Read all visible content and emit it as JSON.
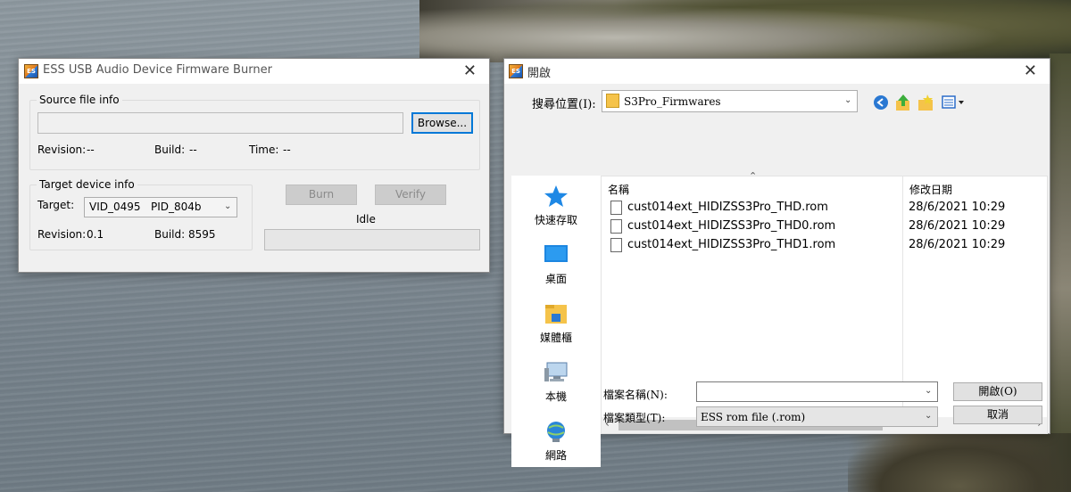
{
  "colors": {
    "accent": "#0078d7",
    "folder_yellow": "#f5c34a",
    "window_bg": "#f0f0f0"
  },
  "burner": {
    "title": "ESS USB Audio Device Firmware Burner",
    "close_label": "✕",
    "source_group_label": "Source file info",
    "source_path_value": "",
    "browse_label": "Browse...",
    "revision_label": "Revision:",
    "revision_value": "--",
    "build_label": "Build:",
    "build_value": "--",
    "time_label": "Time:",
    "time_value": "--",
    "target_group_label": "Target device info",
    "target_label": "Target:",
    "target_value": "VID_0495   PID_804b",
    "device_revision_label": "Revision:",
    "device_revision_value": "0.1",
    "device_build_label": "Build:",
    "device_build_value": "8595",
    "burn_label": "Burn",
    "verify_label": "Verify",
    "status_text": "Idle",
    "progress": 0
  },
  "open_dialog": {
    "title": "開啟",
    "close_label": "✕",
    "look_in_label": "搜尋位置(I):",
    "look_in_value": "S3Pro_Firmwares",
    "toolbar_icons": [
      "back-icon",
      "up-folder-icon",
      "new-folder-icon",
      "view-menu-icon"
    ],
    "places": [
      {
        "label": "快速存取",
        "icon": "quick-access-star-icon"
      },
      {
        "label": "桌面",
        "icon": "desktop-icon"
      },
      {
        "label": "媒體櫃",
        "icon": "libraries-icon"
      },
      {
        "label": "本機",
        "icon": "this-pc-icon"
      },
      {
        "label": "網路",
        "icon": "network-icon"
      }
    ],
    "columns": {
      "name": "名稱",
      "date": "修改日期"
    },
    "files": [
      {
        "name": "cust014ext_HIDIZSS3Pro_THD.rom",
        "date": "28/6/2021 10:29"
      },
      {
        "name": "cust014ext_HIDIZSS3Pro_THD0.rom",
        "date": "28/6/2021 10:29"
      },
      {
        "name": "cust014ext_HIDIZSS3Pro_THD1.rom",
        "date": "28/6/2021 10:29"
      }
    ],
    "filename_label": "檔案名稱(N):",
    "filename_value": "",
    "filetype_label": "檔案類型(T):",
    "filetype_value": "ESS rom file (.rom)",
    "open_label": "開啟(O)",
    "cancel_label": "取消"
  }
}
